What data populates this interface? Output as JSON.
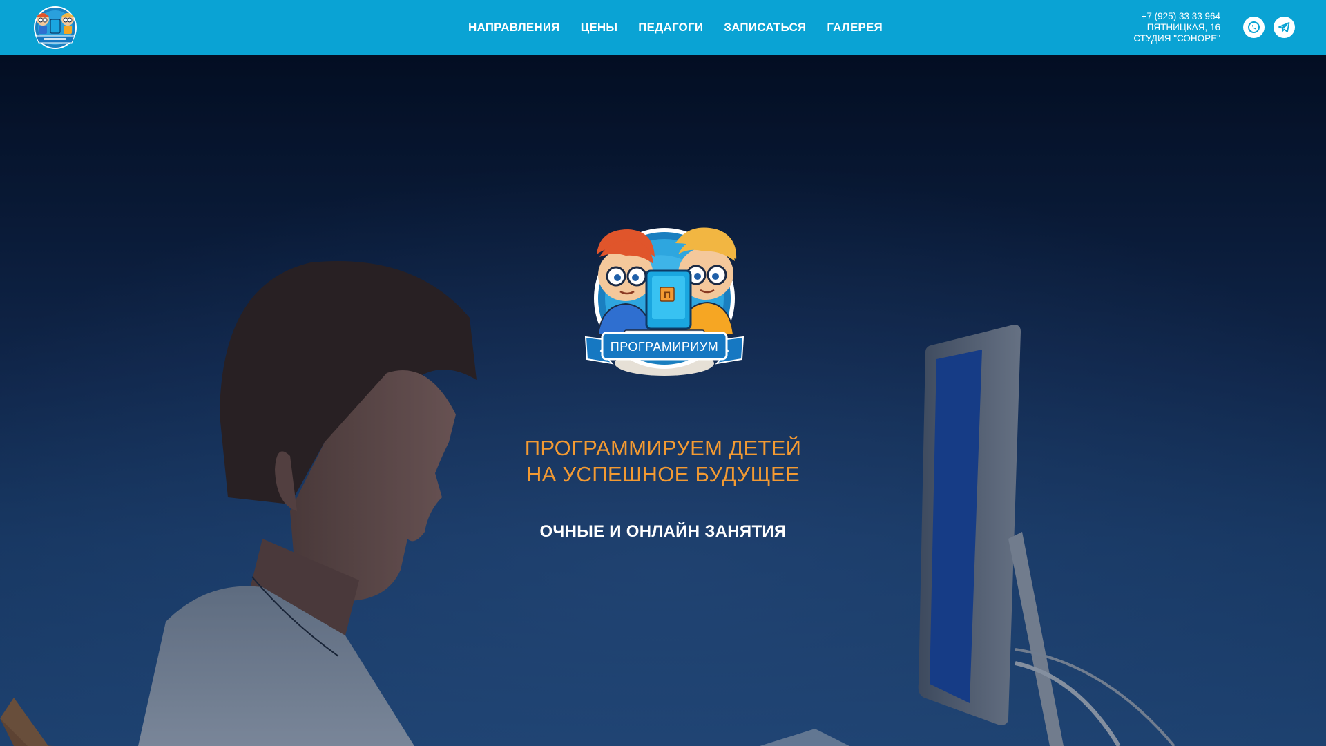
{
  "header": {
    "logo_alt": "Программириум",
    "nav": [
      {
        "label": "НАПРАВЛЕНИЯ"
      },
      {
        "label": "ЦЕНЫ"
      },
      {
        "label": "ПЕДАГОГИ"
      },
      {
        "label": "ЗАПИСАТЬСЯ"
      },
      {
        "label": "ГАЛЕРЕЯ"
      }
    ],
    "contacts": {
      "phone": "+7 (925) 33 33 964",
      "address": "ПЯТНИЦКАЯ, 16",
      "studio": "СТУДИЯ \"СОНОРЕ\""
    },
    "social": [
      {
        "icon": "whatsapp-icon"
      },
      {
        "icon": "telegram-icon"
      }
    ]
  },
  "hero": {
    "logo_ribbon": "ПРОГРАМИРИУМ",
    "logo_screen_letter": "П",
    "title_line1": "ПРОГРАММИРУЕМ ДЕТЕЙ",
    "title_line2": "НА УСПЕШНОЕ БУДУЩЕЕ",
    "subtitle": "ОЧНЫЕ И ОНЛАЙН ЗАНЯТИЯ"
  },
  "colors": {
    "header_bg": "#0aa3d4",
    "accent_orange": "#f39a32",
    "text_white": "#ffffff"
  }
}
